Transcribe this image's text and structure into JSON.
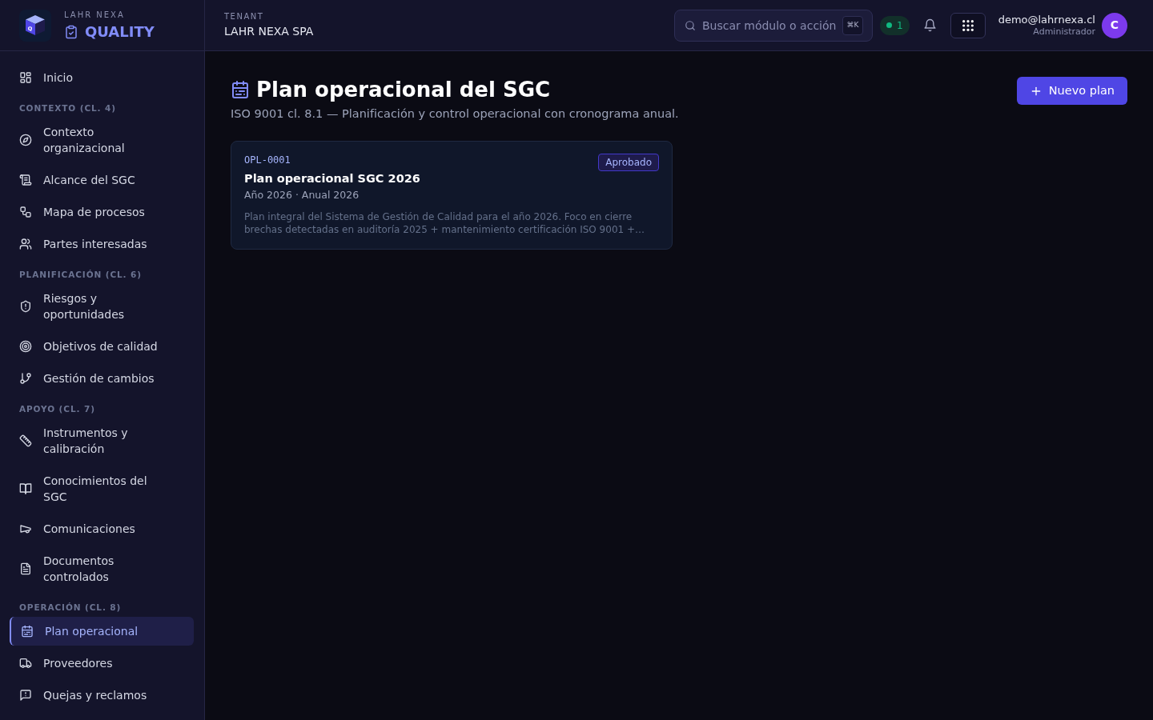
{
  "sidebar": {
    "brand": {
      "logo_letter": "Q",
      "overline": "LAHR NEXA",
      "product": "QUALITY"
    },
    "sections": [
      {
        "items": [
          {
            "label": "Inicio",
            "selected": false
          }
        ]
      },
      {
        "heading": "CONTEXTO (CL. 4)",
        "items": [
          {
            "label": "Contexto organizacional",
            "selected": false
          },
          {
            "label": "Alcance del SGC",
            "selected": false
          },
          {
            "label": "Mapa de procesos",
            "selected": false
          },
          {
            "label": "Partes interesadas",
            "selected": false
          }
        ]
      },
      {
        "heading": "PLANIFICACIÓN (CL. 6)",
        "items": [
          {
            "label": "Riesgos y oportunidades",
            "selected": false
          },
          {
            "label": "Objetivos de calidad",
            "selected": false
          },
          {
            "label": "Gestión de cambios",
            "selected": false
          }
        ]
      },
      {
        "heading": "APOYO (CL. 7)",
        "items": [
          {
            "label": "Instrumentos y calibración",
            "selected": false
          },
          {
            "label": "Conocimientos del SGC",
            "selected": false
          },
          {
            "label": "Comunicaciones",
            "selected": false
          },
          {
            "label": "Documentos controlados",
            "selected": false
          }
        ]
      },
      {
        "heading": "OPERACIÓN (CL. 8)",
        "items": [
          {
            "label": "Plan operacional",
            "selected": true
          },
          {
            "label": "Proveedores",
            "selected": false
          },
          {
            "label": "Quejas y reclamos",
            "selected": false
          }
        ]
      }
    ]
  },
  "topbar": {
    "tenant": {
      "label": "TENANT",
      "name": "LAHR NEXA SPA"
    },
    "search": {
      "placeholder": "Buscar módulo o acción",
      "shortcut": "⌘K"
    },
    "status_count": "1",
    "user": {
      "email": "demo@lahrnexa.cl",
      "role": "Administrador",
      "initial": "C"
    }
  },
  "page": {
    "title": "Plan operacional del SGC",
    "subtitle": "ISO 9001 cl. 8.1 — Planificación y control operacional con cronograma anual.",
    "primary_action": "Nuevo plan"
  },
  "plans": [
    {
      "code": "OPL-0001",
      "title": "Plan operacional SGC 2026",
      "meta": "Año 2026 · Anual 2026",
      "description": "Plan integral del Sistema de Gestión de Calidad para el año 2026. Foco en cierre brechas detectadas en auditoría 2025 + mantenimiento certificación ISO 9001 +…",
      "status": {
        "label": "Aprobado",
        "kind": "approved"
      }
    }
  ]
}
